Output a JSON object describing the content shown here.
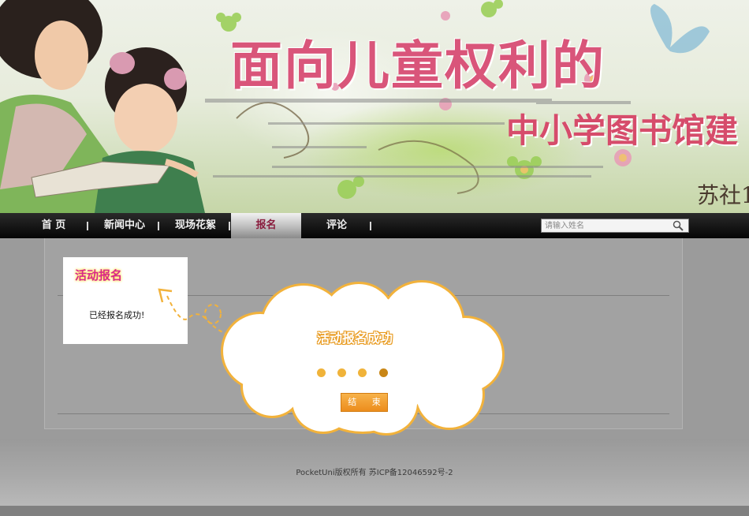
{
  "banner": {
    "title": "面向儿童权利的",
    "subtitle": "中小学图书馆建",
    "corner_text": "苏社1"
  },
  "nav": {
    "items": [
      {
        "label": "首 页",
        "active": false
      },
      {
        "label": "新闻中心",
        "active": false
      },
      {
        "label": "现场花絮",
        "active": false
      },
      {
        "label": "报名",
        "active": true
      },
      {
        "label": "评论",
        "active": false
      }
    ],
    "search_placeholder": "请输入姓名",
    "search_icon": "magnifier-icon"
  },
  "activity": {
    "title": "活动报名",
    "message": "已经报名成功!"
  },
  "popup": {
    "message": "活动报名成功",
    "dots": 4,
    "button_label": "结 束"
  },
  "footer": {
    "text": "PocketUni版权所有 苏ICP备12046592号-2"
  },
  "colors": {
    "accent_pink": "#d8288a",
    "popup_orange": "#ec8d1d",
    "cloud_border": "#f2b23b",
    "nav_bg": "#050505"
  }
}
